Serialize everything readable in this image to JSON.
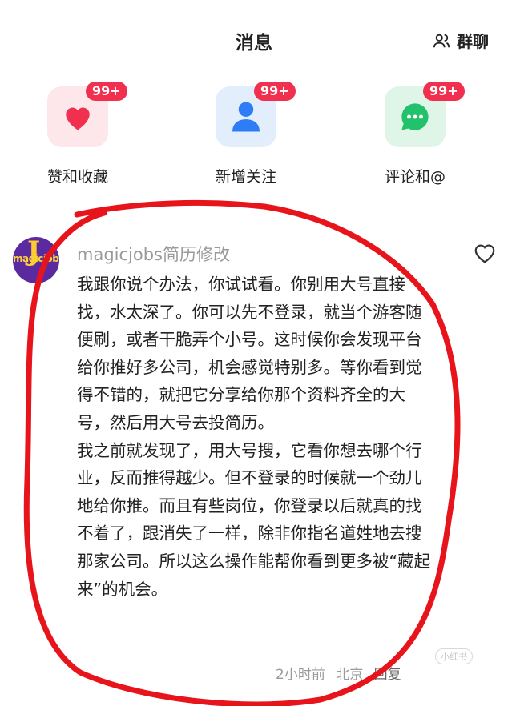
{
  "header": {
    "title": "消息",
    "group_chat_label": "群聊",
    "group_chat_icon": "people-icon"
  },
  "entries": [
    {
      "label": "赞和收藏",
      "badge": "99+",
      "icon": "heart-icon",
      "color": "#f0304e"
    },
    {
      "label": "新增关注",
      "badge": "99+",
      "icon": "person-icon",
      "color": "#2f7df6"
    },
    {
      "label": "评论和@",
      "badge": "99+",
      "icon": "chat-bubble-icon",
      "color": "#22c16b"
    }
  ],
  "comment": {
    "avatar_text": "magicjobs",
    "username": "magicjobs简历修改",
    "body": "我跟你说个办法，你试试看。你别用大号直接找，水太深了。你可以先不登录，就当个游客随便刷，或者干脆弄个小号。这时候你会发现平台给你推好多公司，机会感觉特别多。等你看到觉得不错的，就把它分享给你那个资料齐全的大号，然后用大号去投简历。\n我之前就发现了，用大号搜，它看你想去哪个行业，反而推得越少。但不登录的时候就一个劲儿地给你推。而且有些岗位，你登录以后就真的找不着了，跟消失了一样，除非你指名道姓地去搜那家公司。所以这么操作能帮你看到更多被“藏起来”的机会。",
    "time": "2小时前",
    "location": "北京",
    "reply_label": "回复"
  },
  "watermark": "小红书"
}
